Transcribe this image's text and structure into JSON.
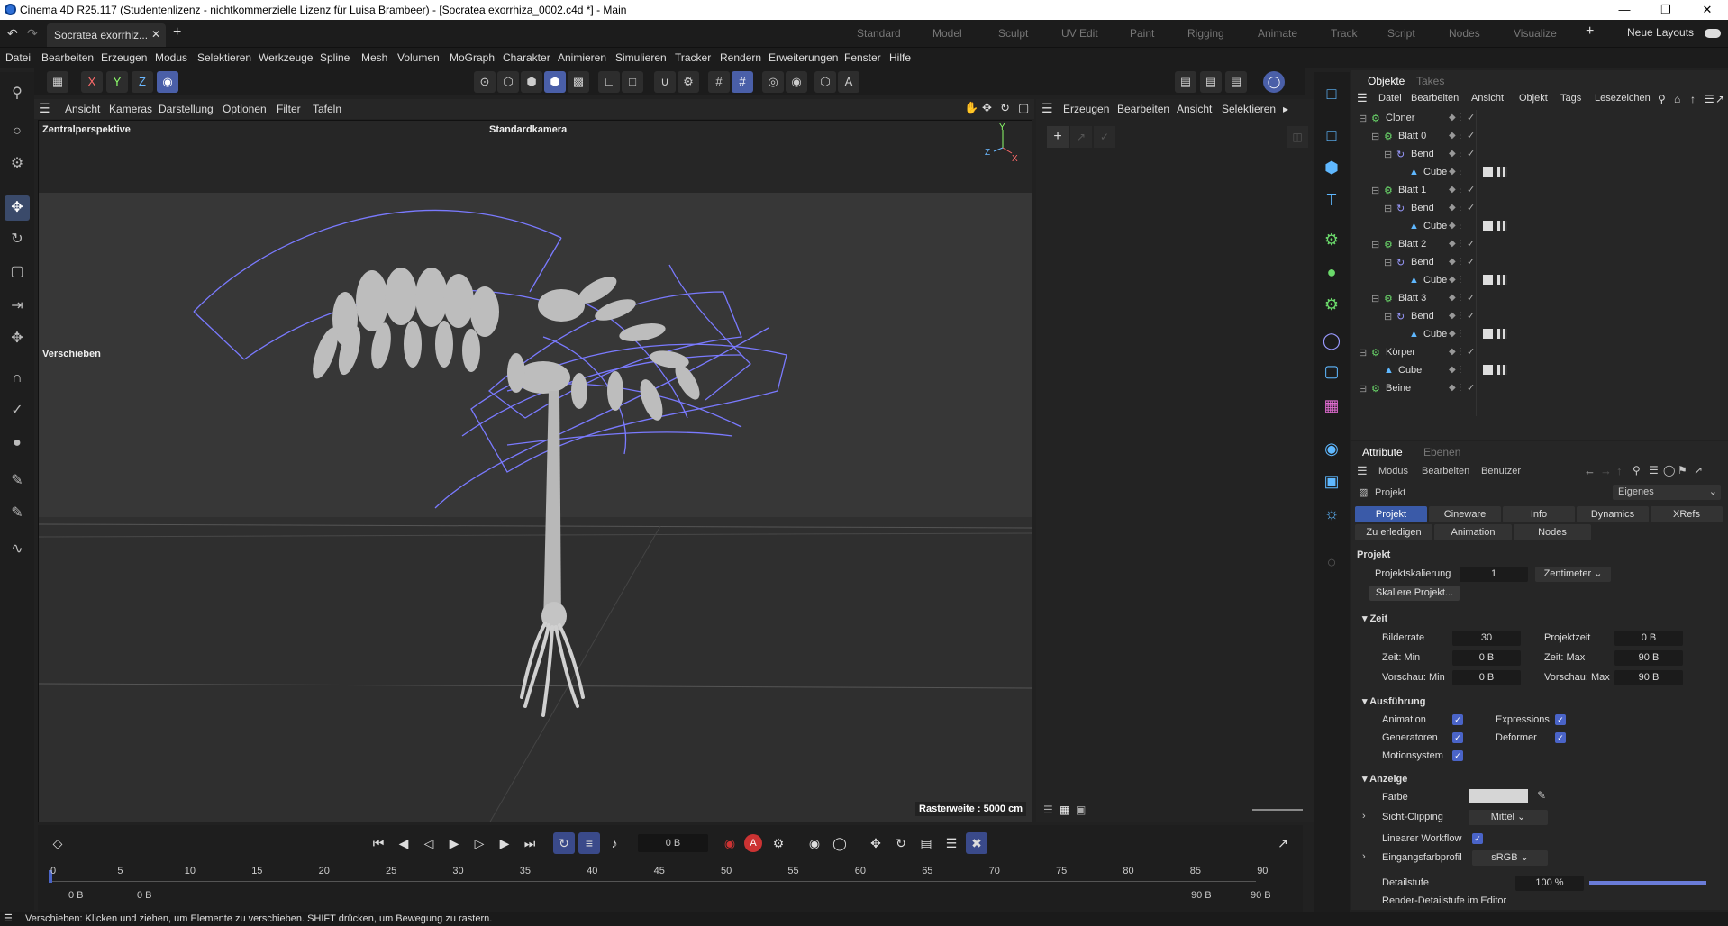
{
  "window": {
    "title": "Cinema 4D R25.117 (Studentenlizenz - nichtkommerzielle Lizenz für Luisa Brambeer) - [Socratea exorrhiza_0002.c4d *] - Main"
  },
  "tabbar": {
    "doc_tab": "Socratea exorrhiz...",
    "layouts": [
      "Standard",
      "Model",
      "Sculpt",
      "UV Edit",
      "Paint",
      "Rigging",
      "Animate",
      "Track",
      "Script",
      "Nodes",
      "Visualize"
    ],
    "new_layouts": "Neue Layouts"
  },
  "menubar": [
    "Datei",
    "Bearbeiten",
    "Erzeugen",
    "Modus",
    "Selektieren",
    "Werkzeuge",
    "Spline",
    "Mesh",
    "Volumen",
    "MoGraph",
    "Charakter",
    "Animieren",
    "Simulieren",
    "Tracker",
    "Rendern",
    "Erweiterungen",
    "Fenster",
    "Hilfe"
  ],
  "toolbar": {
    "axis": [
      "X",
      "Y",
      "Z"
    ]
  },
  "viewport": {
    "menu": [
      "Ansicht",
      "Kameras",
      "Darstellung",
      "Optionen",
      "Filter",
      "Tafeln"
    ],
    "label": "Zentralperspektive",
    "camera": "Standardkamera",
    "move_label": "Verschieben",
    "grid": "Rasterweite : 5000 cm"
  },
  "midpanel": {
    "menu": [
      "Erzeugen",
      "Bearbeiten",
      "Ansicht",
      "Selektieren"
    ]
  },
  "objects": {
    "tabs": [
      "Objekte",
      "Takes"
    ],
    "menu": [
      "Datei",
      "Bearbeiten",
      "Ansicht",
      "Objekt",
      "Tags",
      "Lesezeichen"
    ],
    "items": [
      {
        "name": "Cloner",
        "indent": 0,
        "icon": "cloner"
      },
      {
        "name": "Blatt 0",
        "indent": 1,
        "icon": "null"
      },
      {
        "name": "Bend",
        "indent": 2,
        "icon": "bend"
      },
      {
        "name": "Cube",
        "indent": 3,
        "icon": "cube"
      },
      {
        "name": "Blatt 1",
        "indent": 1,
        "icon": "null"
      },
      {
        "name": "Bend",
        "indent": 2,
        "icon": "bend"
      },
      {
        "name": "Cube",
        "indent": 3,
        "icon": "cube"
      },
      {
        "name": "Blatt 2",
        "indent": 1,
        "icon": "null"
      },
      {
        "name": "Bend",
        "indent": 2,
        "icon": "bend"
      },
      {
        "name": "Cube",
        "indent": 3,
        "icon": "cube"
      },
      {
        "name": "Blatt 3",
        "indent": 1,
        "icon": "null"
      },
      {
        "name": "Bend",
        "indent": 2,
        "icon": "bend"
      },
      {
        "name": "Cube",
        "indent": 3,
        "icon": "cube"
      },
      {
        "name": "Körper",
        "indent": 0,
        "icon": "null"
      },
      {
        "name": "Cube",
        "indent": 1,
        "icon": "cube"
      },
      {
        "name": "Beine",
        "indent": 0,
        "icon": "cloner"
      }
    ]
  },
  "attributes": {
    "tabs": [
      "Attribute",
      "Ebenen"
    ],
    "menu": [
      "Modus",
      "Bearbeiten",
      "Benutzer"
    ],
    "object": "Projekt",
    "mode_select": "Eigenes",
    "subtabs": [
      "Projekt",
      "Cineware",
      "Info",
      "Dynamics",
      "XRefs",
      "Zu erledigen",
      "Animation",
      "Nodes"
    ],
    "section": "Projekt",
    "projektskalierung": {
      "label": "Projektskalierung",
      "value": "1",
      "unit": "Zentimeter"
    },
    "scale_button": "Skaliere Projekt...",
    "zeit": {
      "title": "Zeit",
      "bilderrate": {
        "label": "Bilderrate",
        "value": "30"
      },
      "projektzeit": {
        "label": "Projektzeit",
        "value": "0 B"
      },
      "zeit_min": {
        "label": "Zeit: Min",
        "value": "0 B"
      },
      "zeit_max": {
        "label": "Zeit: Max",
        "value": "90 B"
      },
      "vorschau_min": {
        "label": "Vorschau: Min",
        "value": "0 B"
      },
      "vorschau_max": {
        "label": "Vorschau: Max",
        "value": "90 B"
      }
    },
    "ausfuehrung": {
      "title": "Ausführung",
      "items": [
        "Animation",
        "Expressions",
        "Generatoren",
        "Deformer",
        "Motionsystem"
      ]
    },
    "anzeige": {
      "title": "Anzeige",
      "farbe": "Farbe",
      "sicht_clipping": {
        "label": "Sicht-Clipping",
        "value": "Mittel"
      },
      "linearer_workflow": "Linearer Workflow",
      "eingangsfarbprofil": {
        "label": "Eingangsfarbprofil",
        "value": "sRGB"
      },
      "detailstufe": {
        "label": "Detailstufe",
        "value": "100 %"
      },
      "render_detail": "Render-Detailstufe im Editor"
    }
  },
  "timeline": {
    "current_frame": "0 B",
    "ruler": [
      "0",
      "5",
      "10",
      "15",
      "20",
      "25",
      "30",
      "35",
      "40",
      "45",
      "50",
      "55",
      "60",
      "65",
      "70",
      "75",
      "80",
      "85",
      "90"
    ],
    "start": "0 B",
    "start2": "0 B",
    "end": "90 B",
    "end2": "90 B"
  },
  "status": "Verschieben: Klicken und ziehen, um Elemente zu verschieben. SHIFT drücken, um Bewegung zu rastern.",
  "colors": {
    "accent": "#4a64c8",
    "wire": "#7a7aff"
  }
}
